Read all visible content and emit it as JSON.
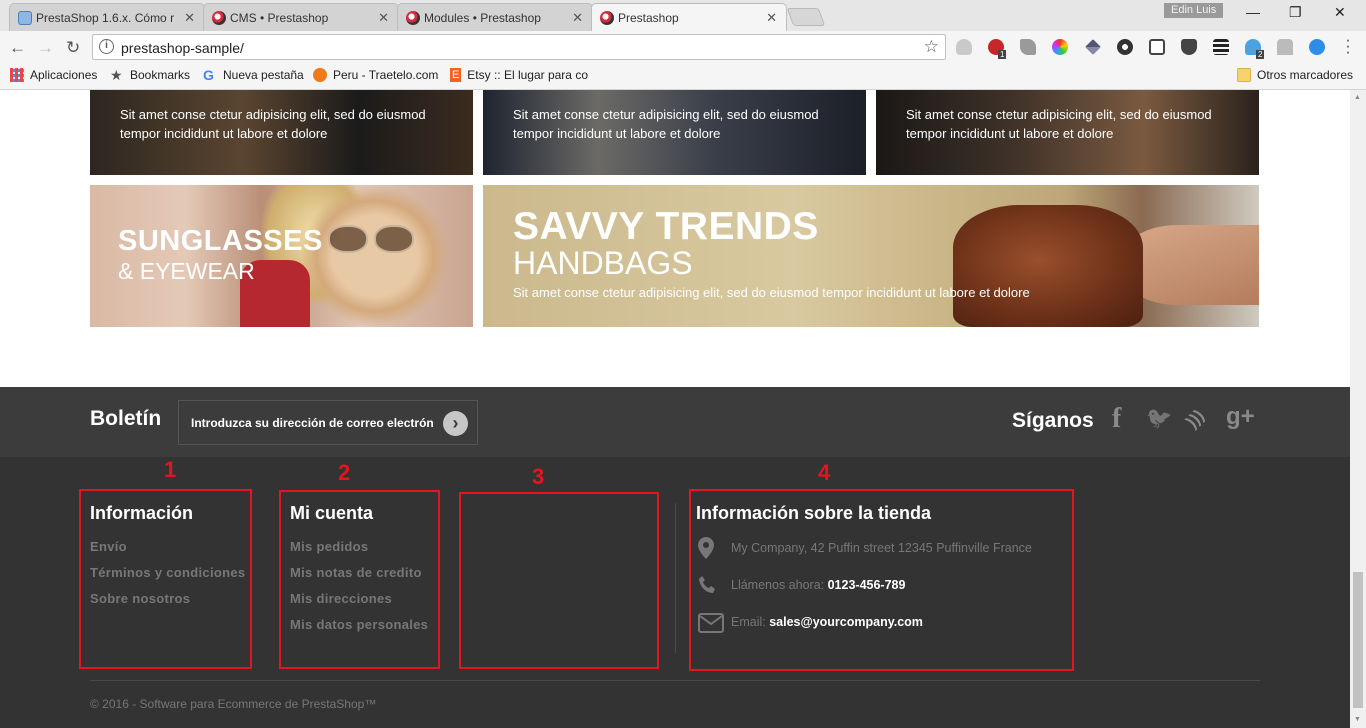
{
  "browser": {
    "tabs": [
      {
        "title": "PrestaShop 1.6.x. Cómo r",
        "close": "✕"
      },
      {
        "title": "CMS • Prestashop",
        "close": "✕"
      },
      {
        "title": "Modules • Prestashop",
        "close": "✕"
      },
      {
        "title": "Prestashop",
        "close": "✕"
      }
    ],
    "profile_name": "Edin Luis",
    "window_controls": {
      "minimize": "—",
      "restore": "❐",
      "close": "✕"
    },
    "nav": {
      "back": "←",
      "forward": "→",
      "reload": "↻"
    },
    "url": "prestashop-sample/",
    "bookmark_star": "☆",
    "extension_badges": {
      "abp": "1",
      "ext12": "2"
    },
    "bookmarks": [
      {
        "label": "Aplicaciones"
      },
      {
        "label": "Bookmarks"
      },
      {
        "label": "Nueva pestaña"
      },
      {
        "label": "Peru - Traetelo.com"
      },
      {
        "label": "Etsy :: El lugar para co"
      }
    ],
    "other_bookmarks": "Otros marcadores"
  },
  "banners": {
    "top_text": "Sit amet conse ctetur adipisicing elit, sed do eiusmod tempor incididunt ut labore et dolore",
    "sunglasses": {
      "line1": "SUNGLASSES",
      "line2": "& EYEWEAR"
    },
    "savvy": {
      "line1": "SAVVY TRENDS",
      "line2": "HANDBAGS",
      "text": "Sit amet conse ctetur adipisicing elit, sed do eiusmod tempor incididunt ut labore et dolore"
    }
  },
  "newsletter": {
    "title": "Boletín",
    "placeholder": "Introduzca su dirección de correo electrón",
    "submit_glyph": "›"
  },
  "social": {
    "title": "Síganos",
    "icons": [
      {
        "name": "facebook-icon",
        "glyph": "f"
      },
      {
        "name": "twitter-icon",
        "glyph": "🐦"
      },
      {
        "name": "rss-icon",
        "glyph": ")))"
      },
      {
        "name": "google-plus-icon",
        "glyph": "g+"
      }
    ]
  },
  "footer": {
    "info": {
      "title": "Información",
      "links": [
        "Envío",
        "Términos y condiciones",
        "Sobre nosotros"
      ]
    },
    "account": {
      "title": "Mi cuenta",
      "links": [
        "Mis pedidos",
        "Mis notas de credito",
        "Mis direcciones",
        "Mis datos personales"
      ]
    },
    "store": {
      "title": "Información sobre la tienda",
      "address": "My Company, 42 Puffin street 12345 Puffinville France",
      "phone_label": "Llámenos ahora:",
      "phone": "0123-456-789",
      "email_label": "Email:",
      "email": "sales@yourcompany.com"
    },
    "copyright": "© 2016 - Software para Ecommerce de PrestaShop™"
  },
  "annotations": {
    "color": "#e3151f",
    "numbers": [
      "1",
      "2",
      "3",
      "4"
    ]
  }
}
